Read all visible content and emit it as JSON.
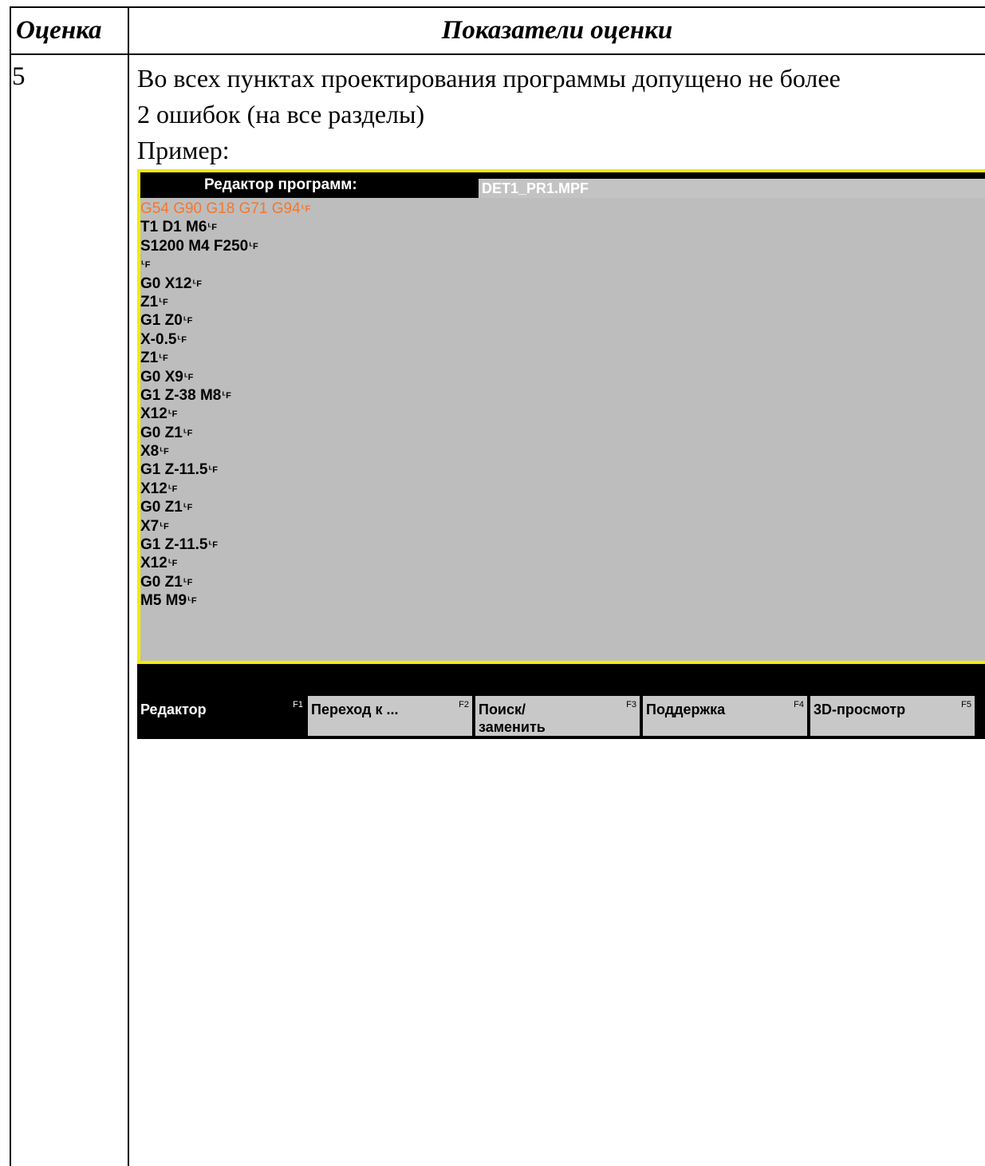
{
  "table": {
    "header": {
      "grade": "Оценка",
      "indicators": "Показатели оценки"
    },
    "row": {
      "grade": "5",
      "description_lines": [
        "Во всех пунктах проектирования программы допущено не более",
        "2 ошибок (на все разделы)",
        "Пример:"
      ]
    }
  },
  "cnc_editor": {
    "title": "Редактор программ:",
    "file": "DET1_PR1.MPF",
    "eol_symbol": "ᒻF",
    "highlight_color": "#f07830",
    "frame_color": "#f2ec00",
    "lines": [
      "G54 G90 G18 G71 G94",
      "T1 D1 M6",
      "S1200 M4 F250",
      "",
      "G0 X12",
      "Z1",
      "G1 Z0",
      "X-0.5",
      "Z1",
      "G0 X9",
      "G1 Z-38 M8",
      "X12",
      "G0 Z1",
      "X8",
      "G1 Z-11.5",
      "X12",
      "G0 Z1",
      "X7",
      "G1 Z-11.5",
      "X12",
      "G0 Z1",
      "M5 M9"
    ],
    "softkeys": [
      {
        "label": "Редактор",
        "fkey": "F1"
      },
      {
        "label": "Переход к ...",
        "fkey": "F2"
      },
      {
        "label": "Поиск/ заменить",
        "fkey": "F3"
      },
      {
        "label": "Поддержка",
        "fkey": "F4"
      },
      {
        "label": "3D-просмотр",
        "fkey": "F5"
      }
    ]
  }
}
